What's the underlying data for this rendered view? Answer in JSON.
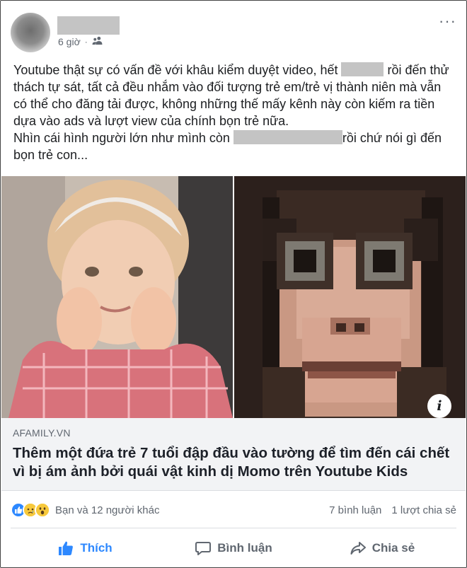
{
  "post": {
    "time": "6 giờ",
    "privacy_icon": "friends-icon",
    "more_label": "···",
    "text": {
      "part1": "Youtube thật sự có vấn đề với khâu kiểm duyệt video, hết ",
      "part2": " rồi đến thử thách tự sát, tất cả đều nhắm vào đối tượng trẻ em/trẻ vị thành niên mà vẫn có thể cho đăng tải được, không những thế mấy kênh này còn kiếm ra tiền dựa vào ads và lượt view của chính bọn trẻ nữa.",
      "part3": "Nhìn cái hình người lớn như mình còn ",
      "part4": "rồi chứ nói gì đến bọn trẻ con..."
    }
  },
  "link": {
    "source": "AFAMILY.VN",
    "headline": "Thêm một đứa trẻ 7 tuổi đập đầu vào tường để tìm đến cái chết vì bị ám ảnh bởi quái vật kinh dị Momo trên Youtube Kids",
    "info_label": "i"
  },
  "stats": {
    "reactions": [
      "like-icon",
      "sad-icon",
      "wow-icon"
    ],
    "people": "Bạn và 12 người khác",
    "comments": "7 bình luận",
    "shares": "1 lượt chia sẻ"
  },
  "actions": {
    "like": "Thích",
    "comment": "Bình luận",
    "share": "Chia sẻ"
  },
  "colors": {
    "accent": "#2d88ff",
    "text_secondary": "#606770",
    "link_bg": "#f2f3f5"
  }
}
